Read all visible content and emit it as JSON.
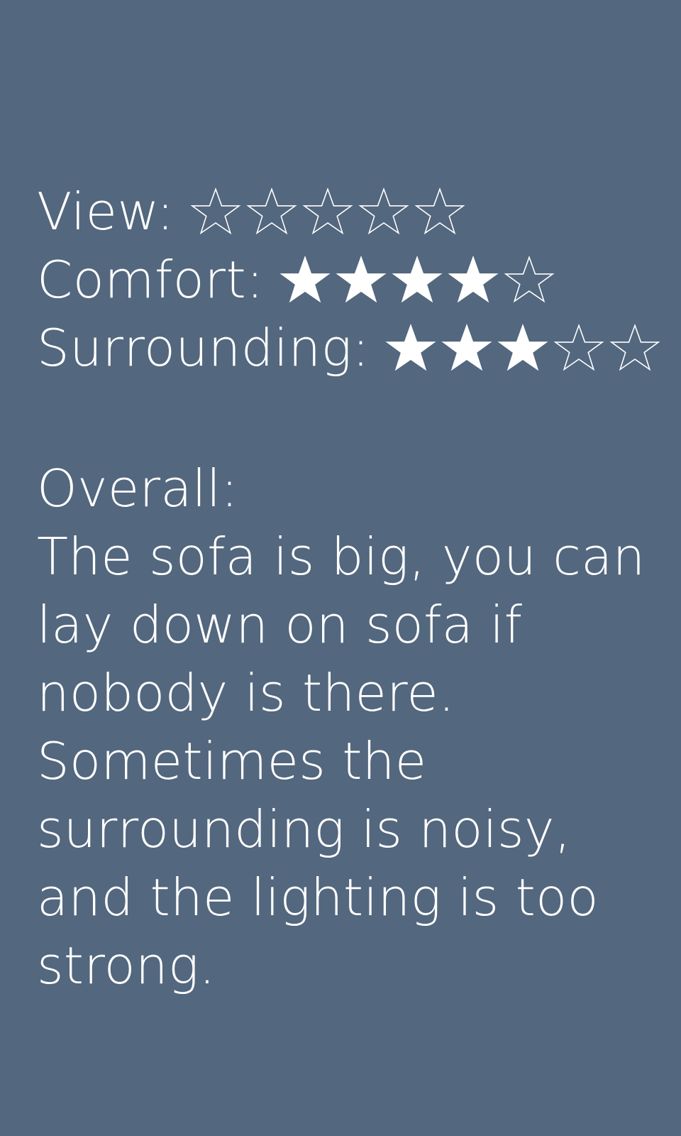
{
  "ratings": [
    {
      "label": "View:",
      "score": 0,
      "max": 5
    },
    {
      "label": "Comfort:",
      "score": 4,
      "max": 5
    },
    {
      "label": "Surrounding:",
      "score": 3,
      "max": 5
    }
  ],
  "overall": {
    "label": "Overall:",
    "text": "The sofa is big, you can lay down on sofa if nobody is there. Sometimes the surrounding is noisy, and the lighting is too strong."
  },
  "colors": {
    "background": "#53677e",
    "text": "#ffffff"
  },
  "icons": {
    "filled_star": "filled-star-icon",
    "empty_star": "empty-star-icon"
  }
}
